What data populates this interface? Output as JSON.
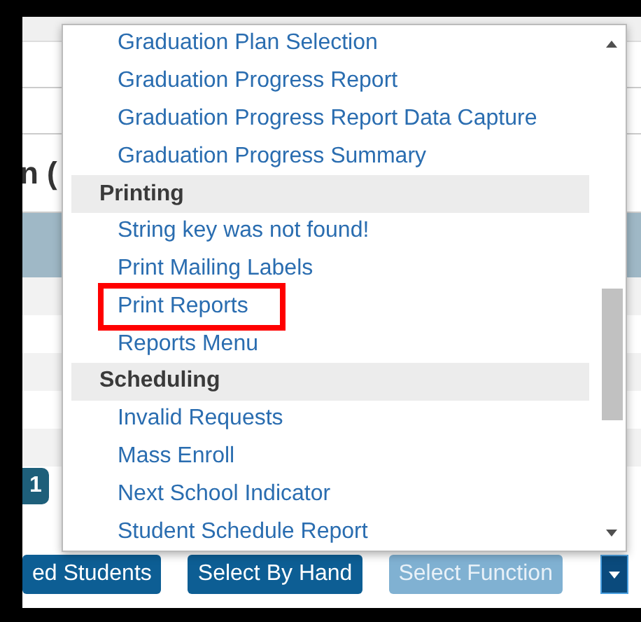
{
  "background": {
    "heading": "n (",
    "page_button": "1"
  },
  "menu": {
    "items": [
      {
        "kind": "item",
        "label": "Graduation Plan Selection",
        "highlighted": false
      },
      {
        "kind": "item",
        "label": "Graduation Progress Report",
        "highlighted": false
      },
      {
        "kind": "item",
        "label": "Graduation Progress Report Data Capture",
        "highlighted": false
      },
      {
        "kind": "item",
        "label": "Graduation Progress Summary",
        "highlighted": false
      },
      {
        "kind": "header",
        "label": "Printing"
      },
      {
        "kind": "item",
        "label": "String key was not found!",
        "highlighted": false
      },
      {
        "kind": "item",
        "label": "Print Mailing Labels",
        "highlighted": false
      },
      {
        "kind": "item",
        "label": "Print Reports",
        "highlighted": true
      },
      {
        "kind": "item",
        "label": "Reports Menu",
        "highlighted": false
      },
      {
        "kind": "header",
        "label": "Scheduling"
      },
      {
        "kind": "item",
        "label": "Invalid Requests",
        "highlighted": false
      },
      {
        "kind": "item",
        "label": "Mass Enroll",
        "highlighted": false
      },
      {
        "kind": "item",
        "label": "Next School Indicator",
        "highlighted": false
      },
      {
        "kind": "item",
        "label": "Student Schedule Report",
        "highlighted": false
      }
    ]
  },
  "buttons": [
    {
      "label": "ed Students",
      "disabled": false
    },
    {
      "label": "Select By Hand",
      "disabled": false
    },
    {
      "label": "Select Function",
      "disabled": true
    }
  ]
}
